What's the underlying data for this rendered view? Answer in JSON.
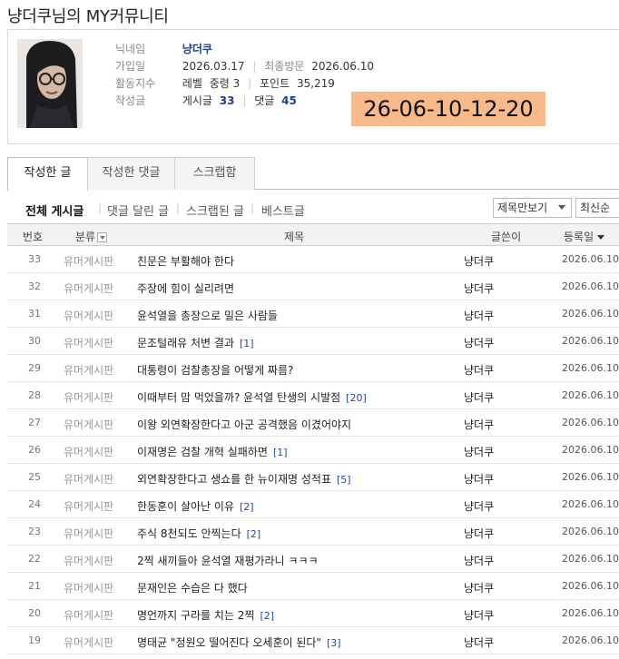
{
  "page": {
    "title": "냥더쿠님의 MY커뮤니티"
  },
  "profile": {
    "nickname_label": "닉네임",
    "nickname": "냥더쿠",
    "joined_label": "가입일",
    "joined": "2026.03.17",
    "last_visit_label": "최종방문",
    "last_visit": "2026.06.10",
    "activity_label": "활동지수",
    "level_label": "레벨",
    "level": "중령 3",
    "points_label": "포인트",
    "points": "35,219",
    "posts_label": "작성글",
    "post_count_label": "게시글",
    "post_count": "33",
    "comment_count_label": "댓글",
    "comment_count": "45"
  },
  "overlay": {
    "date_stamp": "26-06-10-12-20"
  },
  "tabs": [
    {
      "label": "작성한 글",
      "active": true
    },
    {
      "label": "작성한 댓글",
      "active": false
    },
    {
      "label": "스크랩함",
      "active": false
    }
  ],
  "filters": [
    {
      "label": "전체 게시글",
      "active": true
    },
    {
      "label": "댓글 달린 글",
      "active": false
    },
    {
      "label": "스크랩된 글",
      "active": false
    },
    {
      "label": "베스트글",
      "active": false
    }
  ],
  "view_select": {
    "value": "제목만보기"
  },
  "sort_select": {
    "value": "최신순"
  },
  "table": {
    "columns": {
      "num": "번호",
      "category": "분류",
      "title": "제목",
      "writer": "글쓴이",
      "date": "등록일"
    },
    "rows": [
      {
        "num": "33",
        "category": "유머게시판",
        "title": "친문은 부활해야 한다",
        "comments": "",
        "writer": "냥더쿠",
        "date": "2026.06.10"
      },
      {
        "num": "32",
        "category": "유머게시판",
        "title": "주장에 힘이 실리려면",
        "comments": "",
        "writer": "냥더쿠",
        "date": "2026.06.10"
      },
      {
        "num": "31",
        "category": "유머게시판",
        "title": "윤석열을 총장으로 밀은 사람들",
        "comments": "",
        "writer": "냥더쿠",
        "date": "2026.06.10"
      },
      {
        "num": "30",
        "category": "유머게시판",
        "title": "문조털래유 처변 결과",
        "comments": "[1]",
        "writer": "냥더쿠",
        "date": "2026.06.10"
      },
      {
        "num": "29",
        "category": "유머게시판",
        "title": "대통령이 검찰총장을 어떻게 짜름?",
        "comments": "",
        "writer": "냥더쿠",
        "date": "2026.06.10"
      },
      {
        "num": "28",
        "category": "유머게시판",
        "title": "이때부터 맘 먹었을까? 윤석열 탄생의 시발점",
        "comments": "[20]",
        "writer": "냥더쿠",
        "date": "2026.06.10"
      },
      {
        "num": "27",
        "category": "유머게시판",
        "title": "이왕 외연확장한다고 아군 공격했음 이겼어야지",
        "comments": "",
        "writer": "냥더쿠",
        "date": "2026.06.10"
      },
      {
        "num": "26",
        "category": "유머게시판",
        "title": "이재명은 검찰 개혁 실패하면",
        "comments": "[1]",
        "writer": "냥더쿠",
        "date": "2026.06.10"
      },
      {
        "num": "25",
        "category": "유머게시판",
        "title": "외연확장한다고 생쇼를 한 뉴이재명 성적표",
        "comments": "[5]",
        "writer": "냥더쿠",
        "date": "2026.06.10"
      },
      {
        "num": "24",
        "category": "유머게시판",
        "title": "한동훈이 살아난 이유",
        "comments": "[2]",
        "writer": "냥더쿠",
        "date": "2026.06.10"
      },
      {
        "num": "23",
        "category": "유머게시판",
        "title": "주식 8천되도 안찍는다",
        "comments": "[2]",
        "writer": "냥더쿠",
        "date": "2026.06.10"
      },
      {
        "num": "22",
        "category": "유머게시판",
        "title": "2찍 새끼들아 윤석열 재평가라니 ㅋㅋㅋ",
        "comments": "",
        "writer": "냥더쿠",
        "date": "2026.06.10"
      },
      {
        "num": "21",
        "category": "유머게시판",
        "title": "문재인은 수습은 다 했다",
        "comments": "",
        "writer": "냥더쿠",
        "date": "2026.06.10"
      },
      {
        "num": "20",
        "category": "유머게시판",
        "title": "명언까지 구라를 치는 2찍",
        "comments": "[2]",
        "writer": "냥더쿠",
        "date": "2026.06.10"
      },
      {
        "num": "19",
        "category": "유머게시판",
        "title": "명태균 \"정원오 떨어진다 오세훈이 된다\"",
        "comments": "[3]",
        "writer": "냥더쿠",
        "date": "2026.06.10"
      }
    ]
  }
}
